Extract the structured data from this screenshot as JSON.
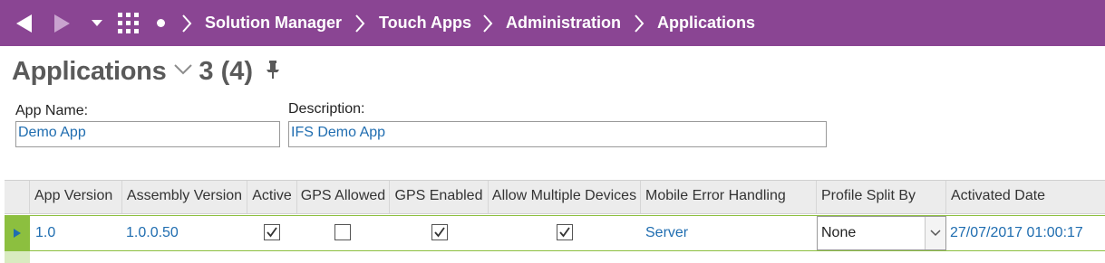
{
  "nav": {
    "back_icon": "arrow-left-icon",
    "forward_icon": "arrow-right-icon",
    "dropdown_icon": "chevron-down-icon",
    "apps_icon": "grid-icon",
    "home_icon": "dot-icon",
    "breadcrumbs": [
      "Solution Manager",
      "Touch Apps",
      "Administration",
      "Applications"
    ],
    "bar_color": "#8a4593"
  },
  "page": {
    "title": "Applications",
    "count": "3 (4)",
    "pin_icon": "pin-icon"
  },
  "fields": {
    "app_name_label": "App Name:",
    "app_name_value": "Demo App",
    "description_label": "Description:",
    "description_value": "IFS Demo App"
  },
  "table": {
    "columns": [
      "App Version",
      "Assembly Version",
      "Active",
      "GPS Allowed",
      "GPS Enabled",
      "Allow Multiple Devices",
      "Mobile Error Handling",
      "Profile Split By",
      "Activated Date"
    ],
    "rows": [
      {
        "app_version": "1.0",
        "assembly_version": "1.0.0.50",
        "active": true,
        "gps_allowed": false,
        "gps_enabled": true,
        "allow_multiple_devices": true,
        "mobile_error_handling": "Server",
        "profile_split_by": "None",
        "activated_date": "27/07/2017 01:00:17"
      }
    ],
    "selected_row_color": "#8cbf3f",
    "link_color": "#1f6db0"
  }
}
